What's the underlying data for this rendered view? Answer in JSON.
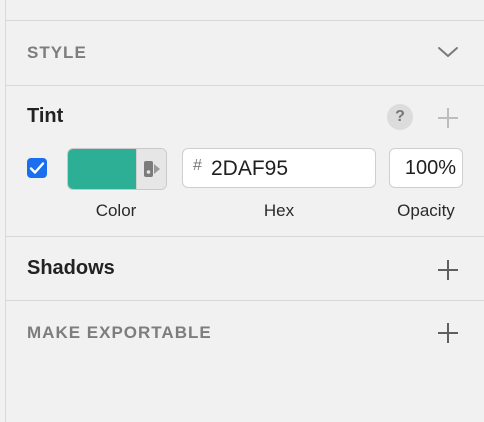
{
  "sections": {
    "style": {
      "title": "STYLE",
      "icon": "chevron-down-icon"
    },
    "tint": {
      "title": "Tint",
      "help_label": "?",
      "enabled": true,
      "color_hex": "#2DAF95",
      "hex_prefix": "#",
      "hex_value": "2DAF95",
      "opacity_value": "100%",
      "labels": {
        "color": "Color",
        "hex": "Hex",
        "opacity": "Opacity"
      }
    },
    "shadows": {
      "title": "Shadows"
    },
    "export": {
      "title": "MAKE EXPORTABLE"
    }
  },
  "colors": {
    "panel_bg": "#f1f1f1",
    "divider": "#d8d8d8",
    "accent_blue": "#1a6ff0",
    "muted_text": "#7d7d7d"
  }
}
